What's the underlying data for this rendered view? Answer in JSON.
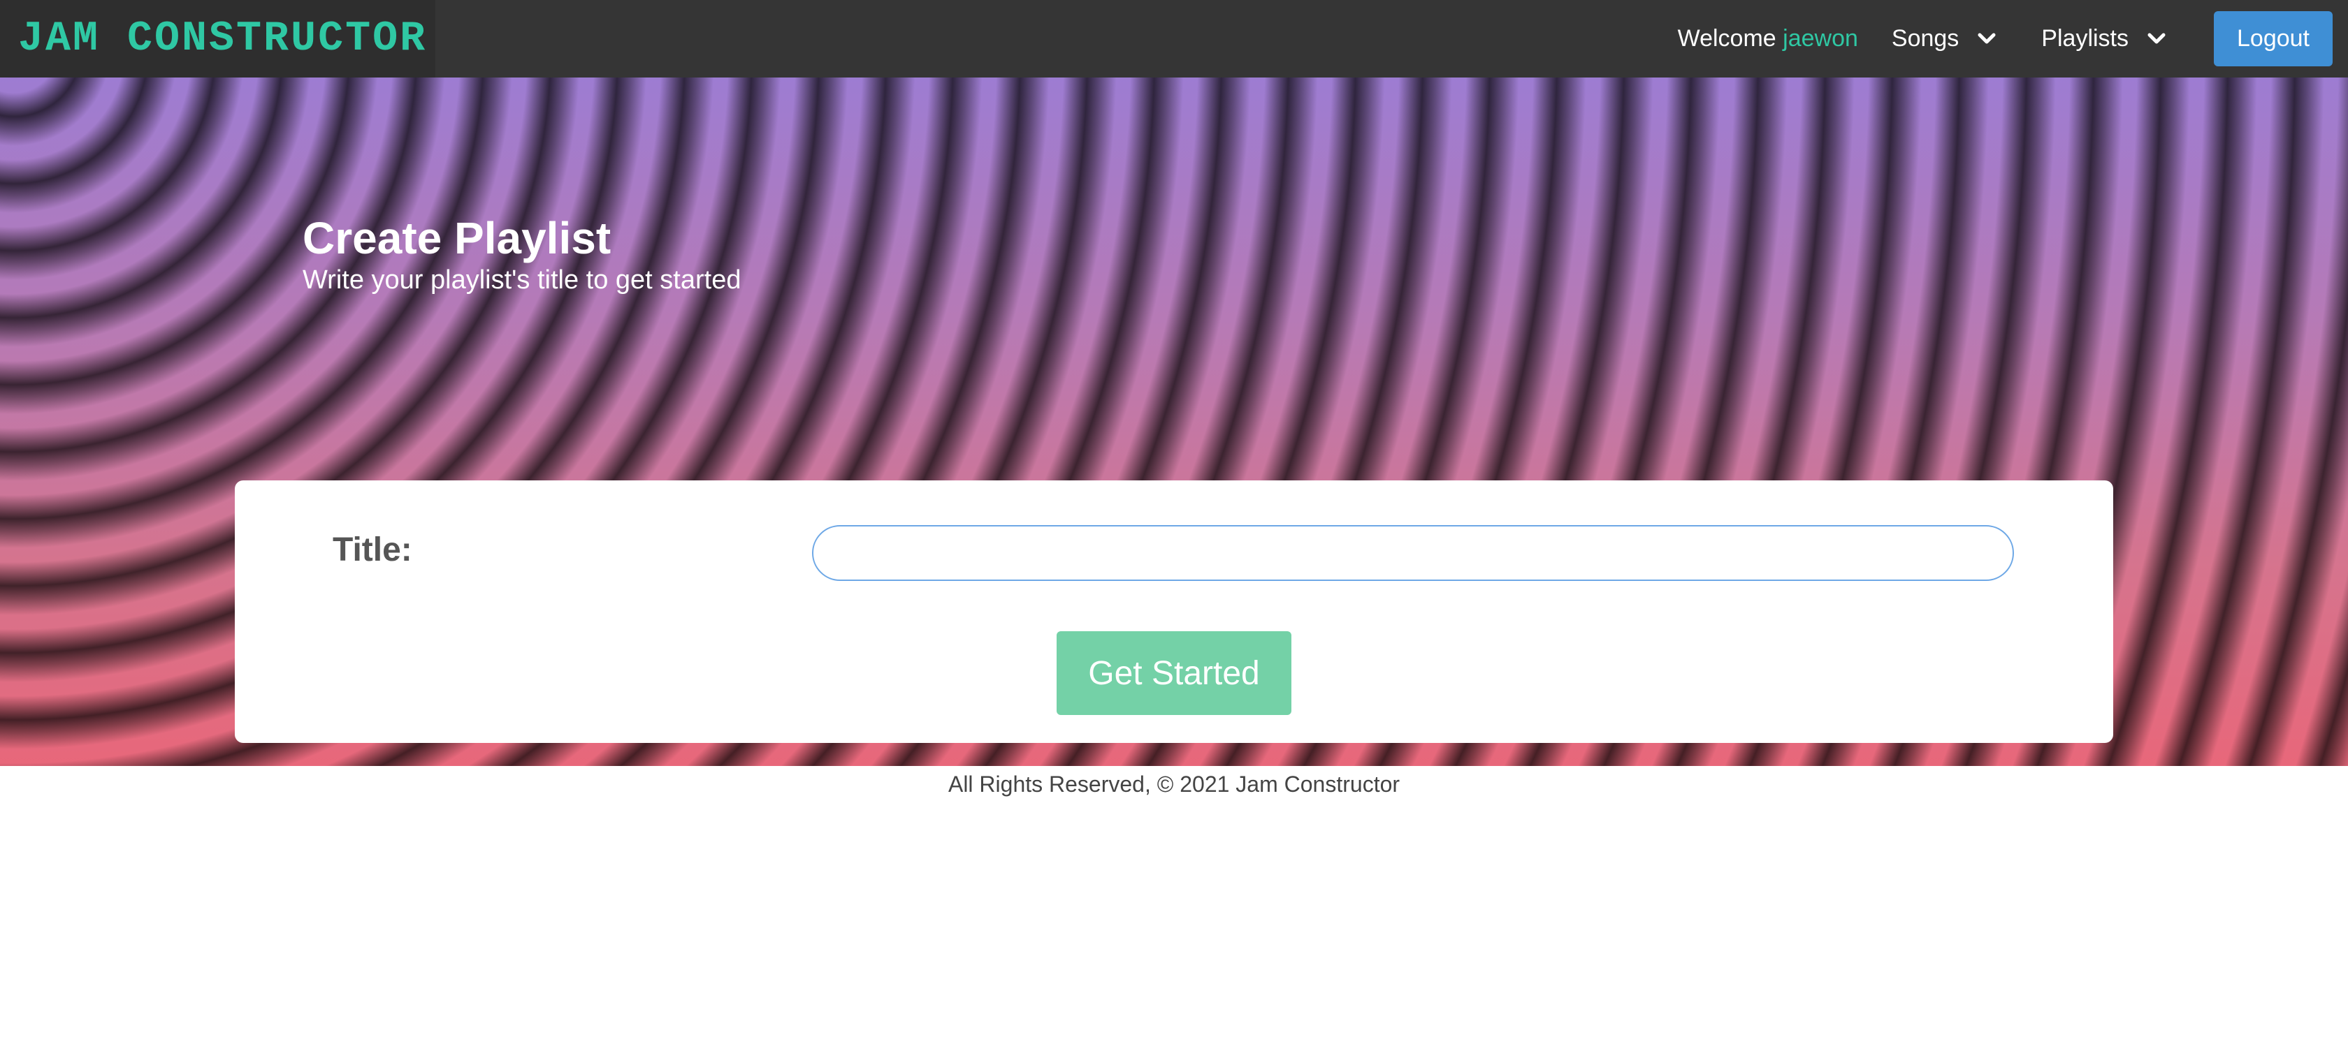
{
  "brand": {
    "title": "JAM CONSTRUCTOR"
  },
  "nav": {
    "welcome_prefix": "Welcome",
    "username": "jaewon",
    "songs_label": "Songs",
    "playlists_label": "Playlists",
    "logout_label": "Logout"
  },
  "hero": {
    "title": "Create Playlist",
    "subtitle": "Write your playlist's title to get started"
  },
  "form": {
    "title_label": "Title:",
    "title_value": "",
    "submit_label": "Get Started"
  },
  "footer": {
    "text": "All Rights Reserved, © 2021 Jam Constructor"
  },
  "colors": {
    "navbar": "#353535",
    "brand_accent": "#2fc8a4",
    "logout_button": "#3f8fd5",
    "submit_button": "#74d1a7",
    "input_border": "#6ea8e6"
  },
  "icons": {
    "songs_dropdown": "chevron-down-icon",
    "playlists_dropdown": "chevron-down-icon"
  }
}
